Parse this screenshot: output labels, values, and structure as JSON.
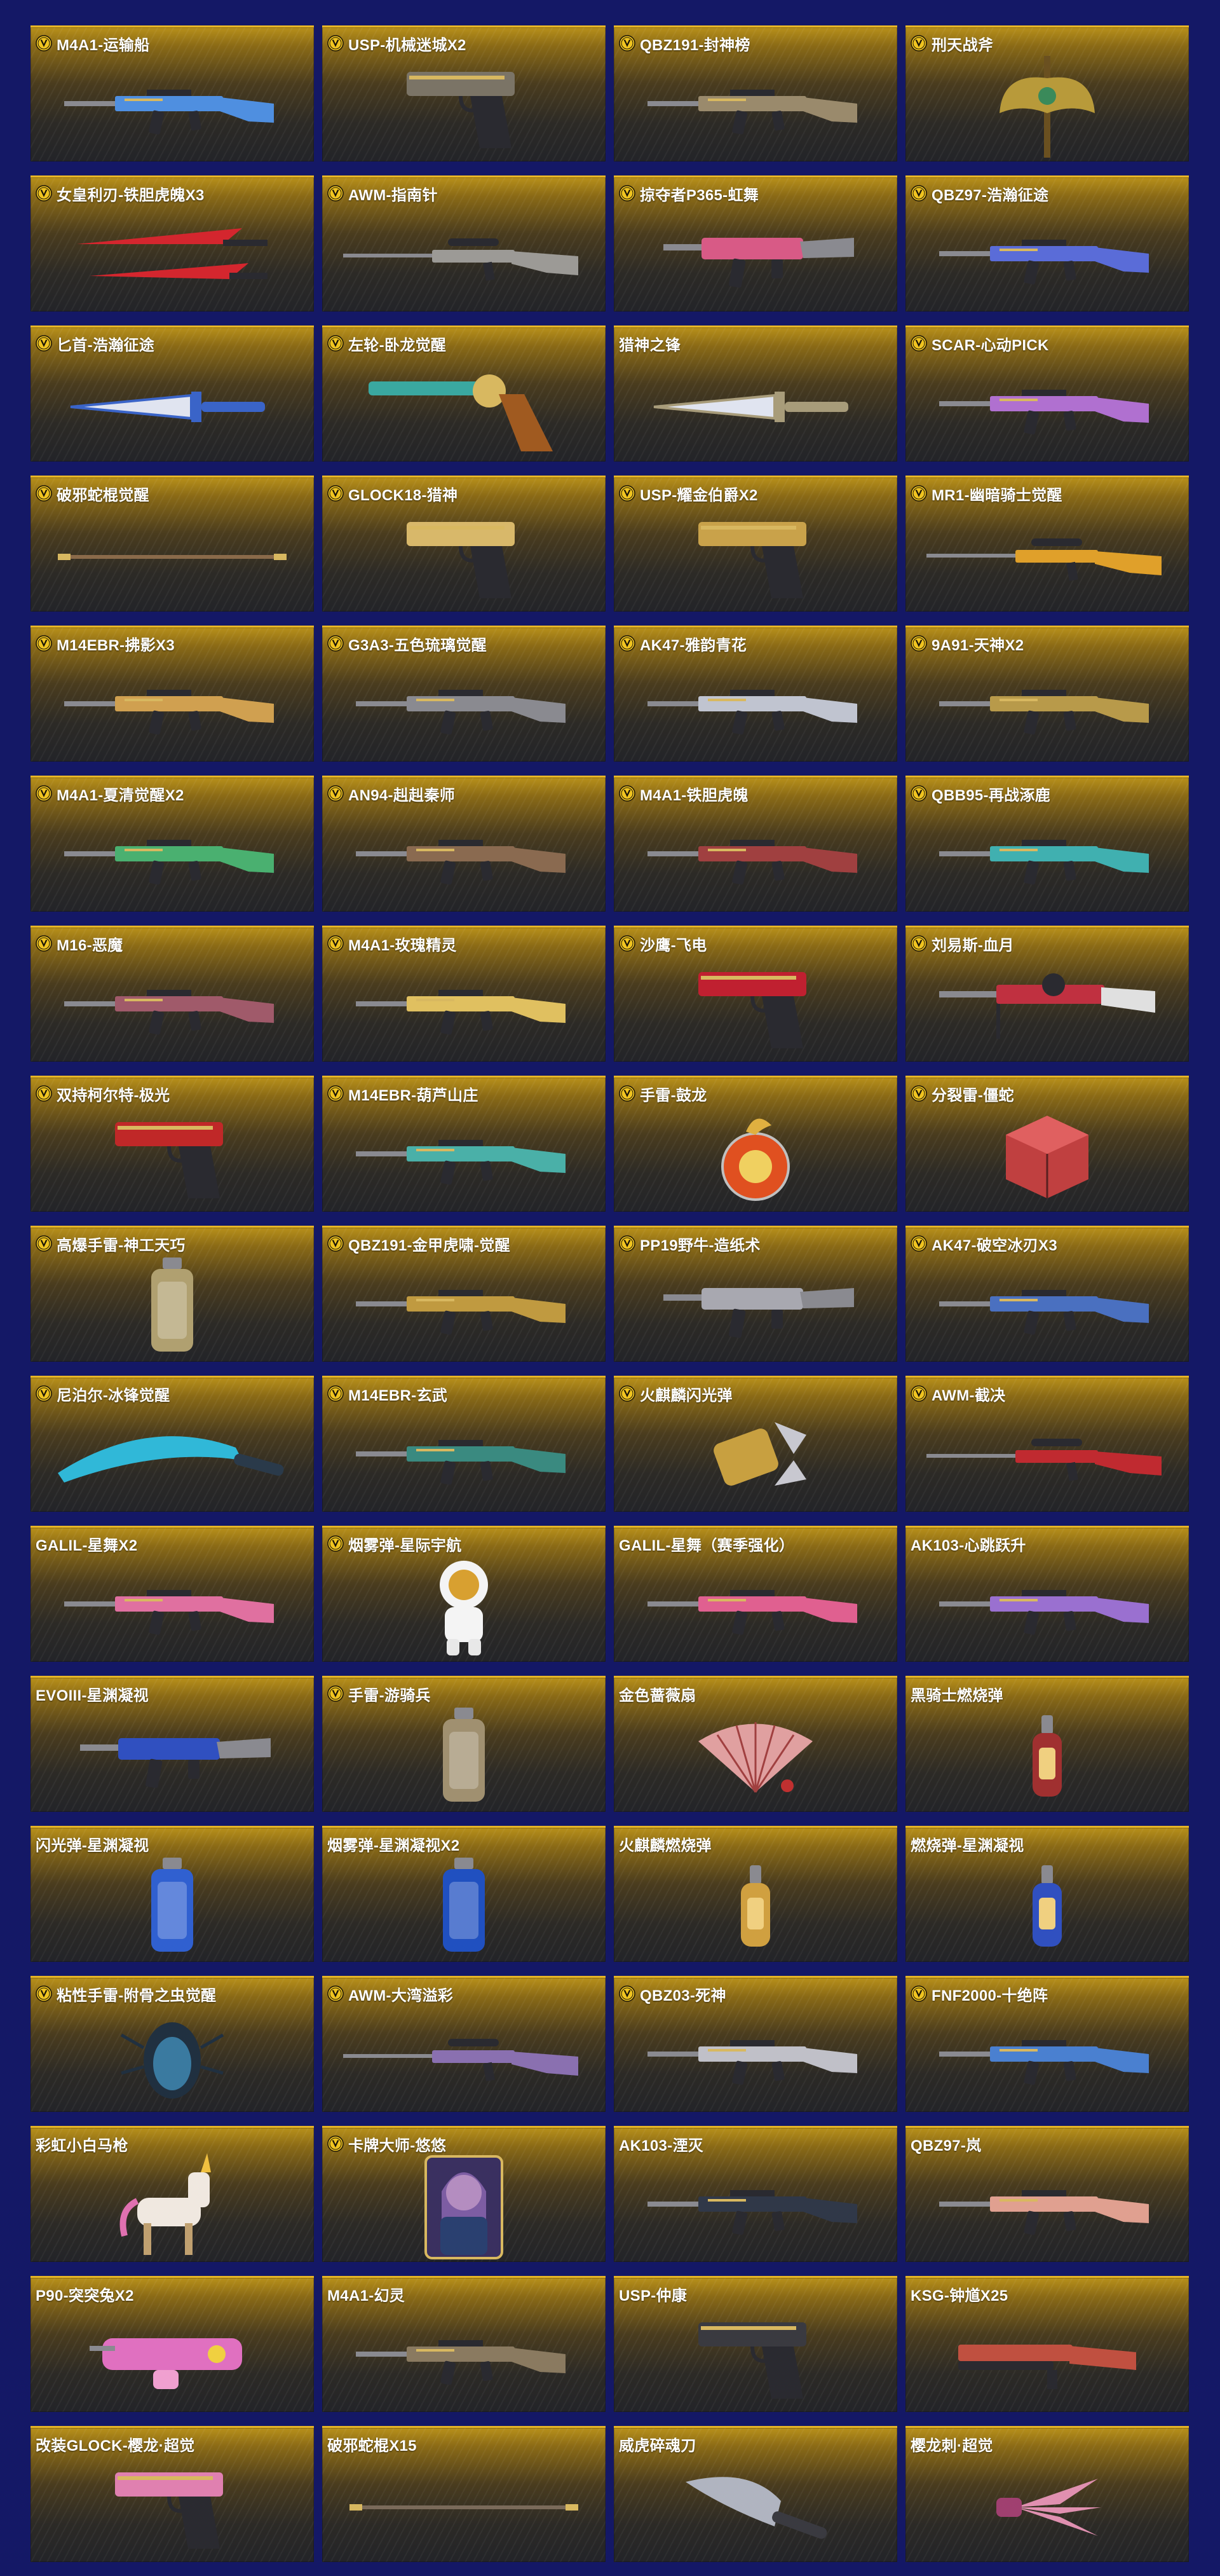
{
  "colors": {
    "page_background": "#141866",
    "card_top": "#b8901a",
    "card_bottom": "#232428",
    "card_border": "#e8b626",
    "badge_fill": "#f0c420",
    "text": "#ffffff"
  },
  "items": [
    {
      "name": "M4A1-运输船",
      "badge": true,
      "icon": "rifle-icon",
      "accent": "#4f8fe0"
    },
    {
      "name": "USP-机械迷城X2",
      "badge": true,
      "icon": "pistol-icon",
      "accent": "#7b7466"
    },
    {
      "name": "QBZ191-封神榜",
      "badge": true,
      "icon": "rifle-icon",
      "accent": "#9a8a6c"
    },
    {
      "name": "刑天战斧",
      "badge": true,
      "icon": "axe-icon",
      "accent": "#b89a3a"
    },
    {
      "name": "女皇利刃-铁胆虎魄X3",
      "badge": true,
      "icon": "blade-icon",
      "accent": "#d4262e"
    },
    {
      "name": "AWM-指南针",
      "badge": true,
      "icon": "sniper-icon",
      "accent": "#9c9a96"
    },
    {
      "name": "掠夺者P365-虹舞",
      "badge": true,
      "icon": "smg-icon",
      "accent": "#d85a86"
    },
    {
      "name": "QBZ97-浩瀚征途",
      "badge": true,
      "icon": "rifle-icon",
      "accent": "#5a6cd8"
    },
    {
      "name": "匕首-浩瀚征途",
      "badge": true,
      "icon": "dagger-icon",
      "accent": "#3a64c8"
    },
    {
      "name": "左轮-卧龙觉醒",
      "badge": true,
      "icon": "revolver-icon",
      "accent": "#3aa8a0"
    },
    {
      "name": "猎神之锋",
      "badge": false,
      "icon": "dagger-icon",
      "accent": "#a89c7a"
    },
    {
      "name": "SCAR-心动PICK",
      "badge": true,
      "icon": "rifle-icon",
      "accent": "#b070d0"
    },
    {
      "name": "破邪蛇棍觉醒",
      "badge": true,
      "icon": "staff-icon",
      "accent": "#8a6a4a"
    },
    {
      "name": "GLOCK18-猎神",
      "badge": true,
      "icon": "pistol-icon",
      "accent": "#d8b86a"
    },
    {
      "name": "USP-耀金伯爵X2",
      "badge": true,
      "icon": "pistol-icon",
      "accent": "#c9a24a"
    },
    {
      "name": "MR1-幽暗骑士觉醒",
      "badge": true,
      "icon": "sniper-icon",
      "accent": "#e0a02a"
    },
    {
      "name": "M14EBR-拂影X3",
      "badge": true,
      "icon": "rifle-icon",
      "accent": "#d0a050"
    },
    {
      "name": "G3A3-五色琉璃觉醒",
      "badge": true,
      "icon": "rifle-icon",
      "accent": "#8a8a90"
    },
    {
      "name": "AK47-雅韵青花",
      "badge": true,
      "icon": "rifle-icon",
      "accent": "#c0c4d0"
    },
    {
      "name": "9A91-天神X2",
      "badge": true,
      "icon": "rifle-icon",
      "accent": "#b89a4a"
    },
    {
      "name": "M4A1-夏清觉醒X2",
      "badge": true,
      "icon": "rifle-icon",
      "accent": "#4ab070"
    },
    {
      "name": "AN94-赳赳秦师",
      "badge": true,
      "icon": "rifle-icon",
      "accent": "#8a6a50"
    },
    {
      "name": "M4A1-铁胆虎魄",
      "badge": true,
      "icon": "rifle-icon",
      "accent": "#a04040"
    },
    {
      "name": "QBB95-再战涿鹿",
      "badge": true,
      "icon": "rifle-icon",
      "accent": "#40b0b0"
    },
    {
      "name": "M16-恶魔",
      "badge": true,
      "icon": "rifle-icon",
      "accent": "#a05a6a"
    },
    {
      "name": "M4A1-玫瑰精灵",
      "badge": true,
      "icon": "rifle-icon",
      "accent": "#e0c060"
    },
    {
      "name": "沙鹰-飞电",
      "badge": true,
      "icon": "pistol-icon",
      "accent": "#c02030"
    },
    {
      "name": "刘易斯-血月",
      "badge": true,
      "icon": "lmg-icon",
      "accent": "#c03040"
    },
    {
      "name": "双持柯尔特-极光",
      "badge": true,
      "icon": "pistol-icon",
      "accent": "#c02828"
    },
    {
      "name": "M14EBR-葫芦山庄",
      "badge": true,
      "icon": "rifle-icon",
      "accent": "#4ab0a8"
    },
    {
      "name": "手雷-鼓龙",
      "badge": true,
      "icon": "grenade-icon",
      "accent": "#e05020"
    },
    {
      "name": "分裂雷-僵蛇",
      "badge": true,
      "icon": "cube-grenade-icon",
      "accent": "#c04040"
    },
    {
      "name": "高爆手雷-神工天巧",
      "badge": true,
      "icon": "canister-icon",
      "accent": "#b0a070"
    },
    {
      "name": "QBZ191-金甲虎啸-觉醒",
      "badge": true,
      "icon": "rifle-icon",
      "accent": "#c09a40"
    },
    {
      "name": "PP19野牛-造纸术",
      "badge": true,
      "icon": "smg-icon",
      "accent": "#a8a8b0"
    },
    {
      "name": "AK47-破空冰刃X3",
      "badge": true,
      "icon": "rifle-icon",
      "accent": "#4a70c0"
    },
    {
      "name": "尼泊尔-冰锋觉醒",
      "badge": true,
      "icon": "kukri-icon",
      "accent": "#30b8d8"
    },
    {
      "name": "M14EBR-玄武",
      "badge": true,
      "icon": "rifle-icon",
      "accent": "#3a8a80"
    },
    {
      "name": "火麒麟闪光弹",
      "badge": true,
      "icon": "flashbang-icon",
      "accent": "#c8a040"
    },
    {
      "name": "AWM-截决",
      "badge": true,
      "icon": "sniper-icon",
      "accent": "#c02a30"
    },
    {
      "name": "GALIL-星舞X2",
      "badge": false,
      "icon": "rifle-icon",
      "accent": "#e070a0"
    },
    {
      "name": "烟雾弹-星际宇航",
      "badge": true,
      "icon": "astronaut-icon",
      "accent": "#f0f0f0"
    },
    {
      "name": "GALIL-星舞（赛季强化）",
      "badge": false,
      "icon": "rifle-icon",
      "accent": "#e06090"
    },
    {
      "name": "AK103-心跳跃升",
      "badge": false,
      "icon": "rifle-icon",
      "accent": "#9a70d0"
    },
    {
      "name": "EVOIII-星渊凝视",
      "badge": false,
      "icon": "smg-icon",
      "accent": "#3050c0"
    },
    {
      "name": "手雷-游骑兵",
      "badge": true,
      "icon": "canister-icon",
      "accent": "#a09070"
    },
    {
      "name": "金色蔷薇扇",
      "badge": false,
      "icon": "fan-icon",
      "accent": "#e0a0a0"
    },
    {
      "name": "黑骑士燃烧弹",
      "badge": false,
      "icon": "molotov-icon",
      "accent": "#a03030"
    },
    {
      "name": "闪光弹-星渊凝视",
      "badge": false,
      "icon": "canister-icon",
      "accent": "#3060d0"
    },
    {
      "name": "烟雾弹-星渊凝视X2",
      "badge": false,
      "icon": "canister-icon",
      "accent": "#2050c0"
    },
    {
      "name": "火麒麟燃烧弹",
      "badge": false,
      "icon": "molotov-icon",
      "accent": "#d0a040"
    },
    {
      "name": "燃烧弹-星渊凝视",
      "badge": false,
      "icon": "molotov-icon",
      "accent": "#3050c0"
    },
    {
      "name": "粘性手雷-附骨之虫觉醒",
      "badge": true,
      "icon": "beetle-icon",
      "accent": "#3a7aa0"
    },
    {
      "name": "AWM-大湾溢彩",
      "badge": true,
      "icon": "sniper-icon",
      "accent": "#8a70b0"
    },
    {
      "name": "QBZ03-死神",
      "badge": true,
      "icon": "rifle-icon",
      "accent": "#c0c0c8"
    },
    {
      "name": "FNF2000-十绝阵",
      "badge": true,
      "icon": "rifle-icon",
      "accent": "#4a80d0"
    },
    {
      "name": "彩虹小白马枪",
      "badge": false,
      "icon": "unicorn-icon",
      "accent": "#f0e8e0"
    },
    {
      "name": "卡牌大师-悠悠",
      "badge": true,
      "icon": "character-card-icon",
      "accent": "#9a70c0"
    },
    {
      "name": "AK103-湮灭",
      "badge": false,
      "icon": "rifle-icon",
      "accent": "#303848"
    },
    {
      "name": "QBZ97-岚",
      "badge": false,
      "icon": "rifle-icon",
      "accent": "#e0a090"
    },
    {
      "name": "P90-突突兔X2",
      "badge": false,
      "icon": "p90-icon",
      "accent": "#e070c0"
    },
    {
      "name": "M4A1-幻灵",
      "badge": false,
      "icon": "rifle-icon",
      "accent": "#8a7a60"
    },
    {
      "name": "USP-仲康",
      "badge": false,
      "icon": "pistol-icon",
      "accent": "#3a3a40"
    },
    {
      "name": "KSG-钟馗X25",
      "badge": false,
      "icon": "shotgun-icon",
      "accent": "#c05040"
    },
    {
      "name": "改装GLOCK-樱龙·超觉",
      "badge": false,
      "icon": "pistol-icon",
      "accent": "#e080b0"
    },
    {
      "name": "破邪蛇棍X15",
      "badge": false,
      "icon": "staff-icon",
      "accent": "#7a6a5a"
    },
    {
      "name": "威虎碎魂刀",
      "badge": false,
      "icon": "cleaver-icon",
      "accent": "#b0b4c0"
    },
    {
      "name": "樱龙刺·超觉",
      "badge": false,
      "icon": "claw-icon",
      "accent": "#e090b0"
    }
  ]
}
